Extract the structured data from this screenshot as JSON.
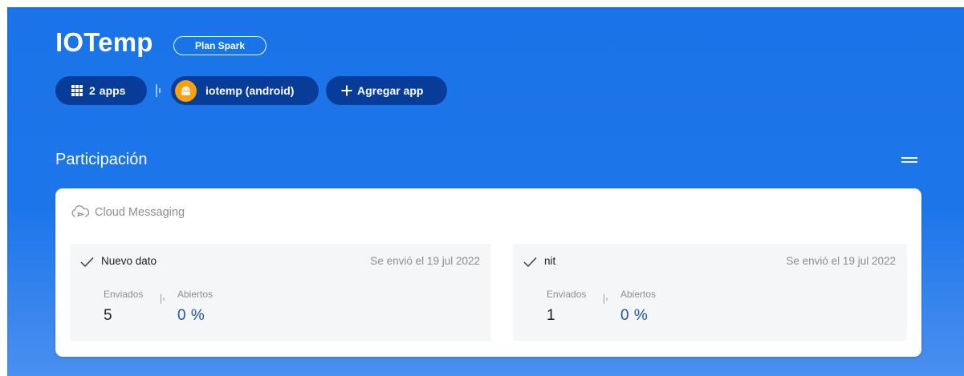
{
  "project": {
    "name": "IOTemp",
    "plan": "Plan Spark"
  },
  "apps": {
    "count": "2",
    "count_label": "apps",
    "current_app": "iotemp (android)",
    "add_label": "Agregar app"
  },
  "engagement": {
    "title": "Participación"
  },
  "messaging": {
    "header": "Cloud Messaging",
    "campaigns": [
      {
        "name": "Nuevo dato",
        "sent": "Se envió el 19 jul 2022",
        "sent_label": "Enviados",
        "sent_value": "5",
        "opened_label": "Abiertos",
        "opened_value": "0 %"
      },
      {
        "name": "nit",
        "sent": "Se envió el 19 jul 2022",
        "sent_label": "Enviados",
        "sent_value": "1",
        "opened_label": "Abiertos",
        "opened_value": "0 %"
      }
    ]
  },
  "colors": {
    "hero_blue": "#1a73e8",
    "pill_dark": "#05348c",
    "android_orange": "#f9a010",
    "metric_blue": "#1a55b8"
  },
  "icons": {
    "apps": "grid-icon",
    "app": "android-icon",
    "add": "plus-icon",
    "menu": "menu-icon",
    "messaging": "cloud-icon",
    "status": "check-icon"
  }
}
